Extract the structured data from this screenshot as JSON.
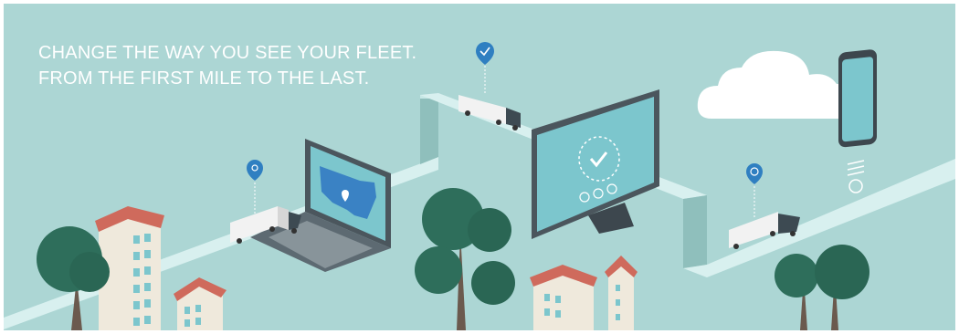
{
  "headline": {
    "line1": "CHANGE THE WAY YOU SEE YOUR FLEET.",
    "line2": "FROM THE FIRST MILE TO THE LAST."
  },
  "colors": {
    "background": "#acd6d4",
    "road": "#d8f0ef",
    "road_side": "#8fbfbc",
    "truck_body": "#f2f2f2",
    "truck_cab": "#3d4a52",
    "pin": "#2f7fc1",
    "tree": "#2e6e5b",
    "building_cream": "#efe9dc",
    "roof": "#cf6a5c",
    "device_frame": "#4b565d",
    "screen": "#7cc6cd",
    "map_blue": "#3a82c4",
    "cloud": "#ffffff"
  },
  "icons": {
    "pin_location": "location-pin-icon",
    "pin_check": "check-pin-icon",
    "pin_sync": "sync-pin-icon",
    "screen_check": "check-circle-icon",
    "phone_menu": "menu-lines-icon"
  }
}
